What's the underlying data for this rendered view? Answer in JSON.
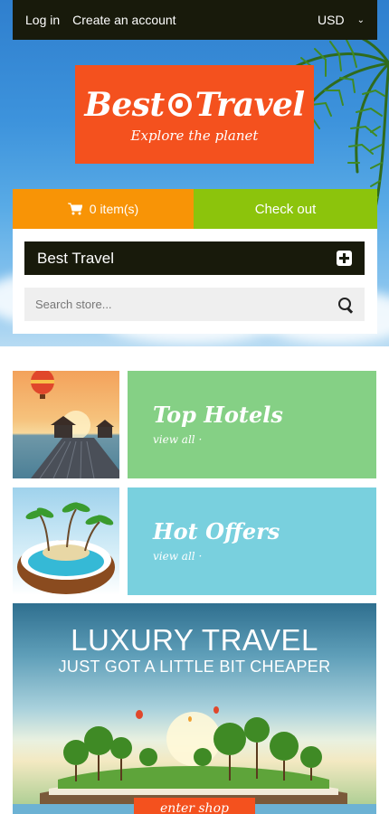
{
  "topbar": {
    "login_label": "Log in",
    "create_account_label": "Create an account",
    "currency": "USD"
  },
  "logo": {
    "title_part1": "Best",
    "title_part2": "Travel",
    "tagline": "Explore the planet"
  },
  "cart": {
    "items_label": "0 item(s)",
    "checkout_label": "Check out"
  },
  "menu": {
    "title": "Best Travel"
  },
  "search": {
    "placeholder": "Search store..."
  },
  "categories": [
    {
      "title": "Top Hotels",
      "link": "view all ·"
    },
    {
      "title": "Hot Offers",
      "link": "view all ·"
    }
  ],
  "banner": {
    "title": "LUXURY TRAVEL",
    "subtitle": "JUST GOT A LITTLE BIT CHEAPER",
    "button_label": "enter shop"
  },
  "colors": {
    "topbar_bg": "#181a0b",
    "logo_bg": "#f4511e",
    "cart_bg": "#f89406",
    "checkout_bg": "#8cc40c",
    "hotels_bg": "#85d085",
    "offers_bg": "#79d0de"
  }
}
